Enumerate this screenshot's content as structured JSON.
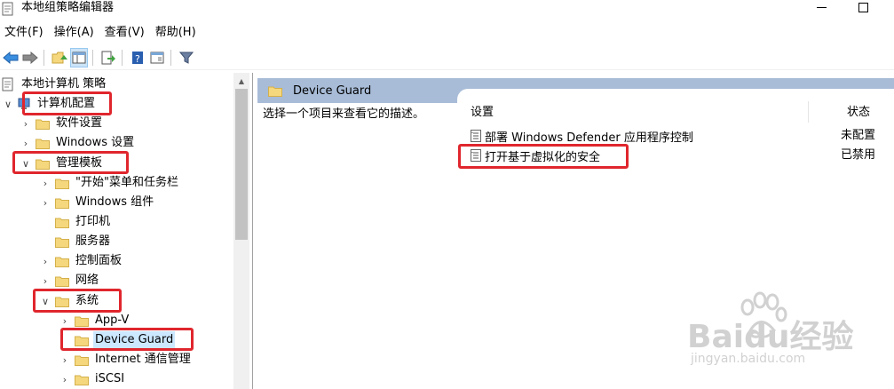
{
  "window": {
    "title": "本地组策略编辑器"
  },
  "menu": [
    {
      "label": "文件(F)"
    },
    {
      "label": "操作(A)"
    },
    {
      "label": "查看(V)"
    },
    {
      "label": "帮助(H)"
    }
  ],
  "toolbar": {
    "buttons": [
      "back-icon",
      "forward-icon",
      "up-folder-icon",
      "show-hide-tree-icon",
      "export-list-icon",
      "help-icon",
      "properties-icon",
      "filter-icon"
    ]
  },
  "tree": {
    "root": "本地计算机 策略",
    "computer_config": "计算机配置",
    "software_settings": "软件设置",
    "windows_settings": "Windows 设置",
    "admin_templates": "管理模板",
    "start_menu": "\"开始\"菜单和任务栏",
    "windows_components": "Windows 组件",
    "printers": "打印机",
    "server": "服务器",
    "control_panel": "控制面板",
    "network": "网络",
    "system": "系统",
    "app_v": "App-V",
    "device_guard": "Device Guard",
    "internet_comm": "Internet 通信管理",
    "iscsi": "iSCSI"
  },
  "right": {
    "header": "Device Guard",
    "description": "选择一个项目来查看它的描述。",
    "col_setting": "设置",
    "col_state": "状态",
    "policies": [
      {
        "name": "部署 Windows Defender 应用程序控制",
        "state": "未配置"
      },
      {
        "name": "打开基于虚拟化的安全",
        "state": "已禁用"
      }
    ]
  },
  "watermark": {
    "brand": "Baidu经验",
    "url": "jingyan.baidu.com"
  },
  "colors": {
    "highlight": "#e0262d",
    "header_band": "#a8bcd8",
    "selected": "#cce8ff",
    "folder": "#f5d77e"
  }
}
